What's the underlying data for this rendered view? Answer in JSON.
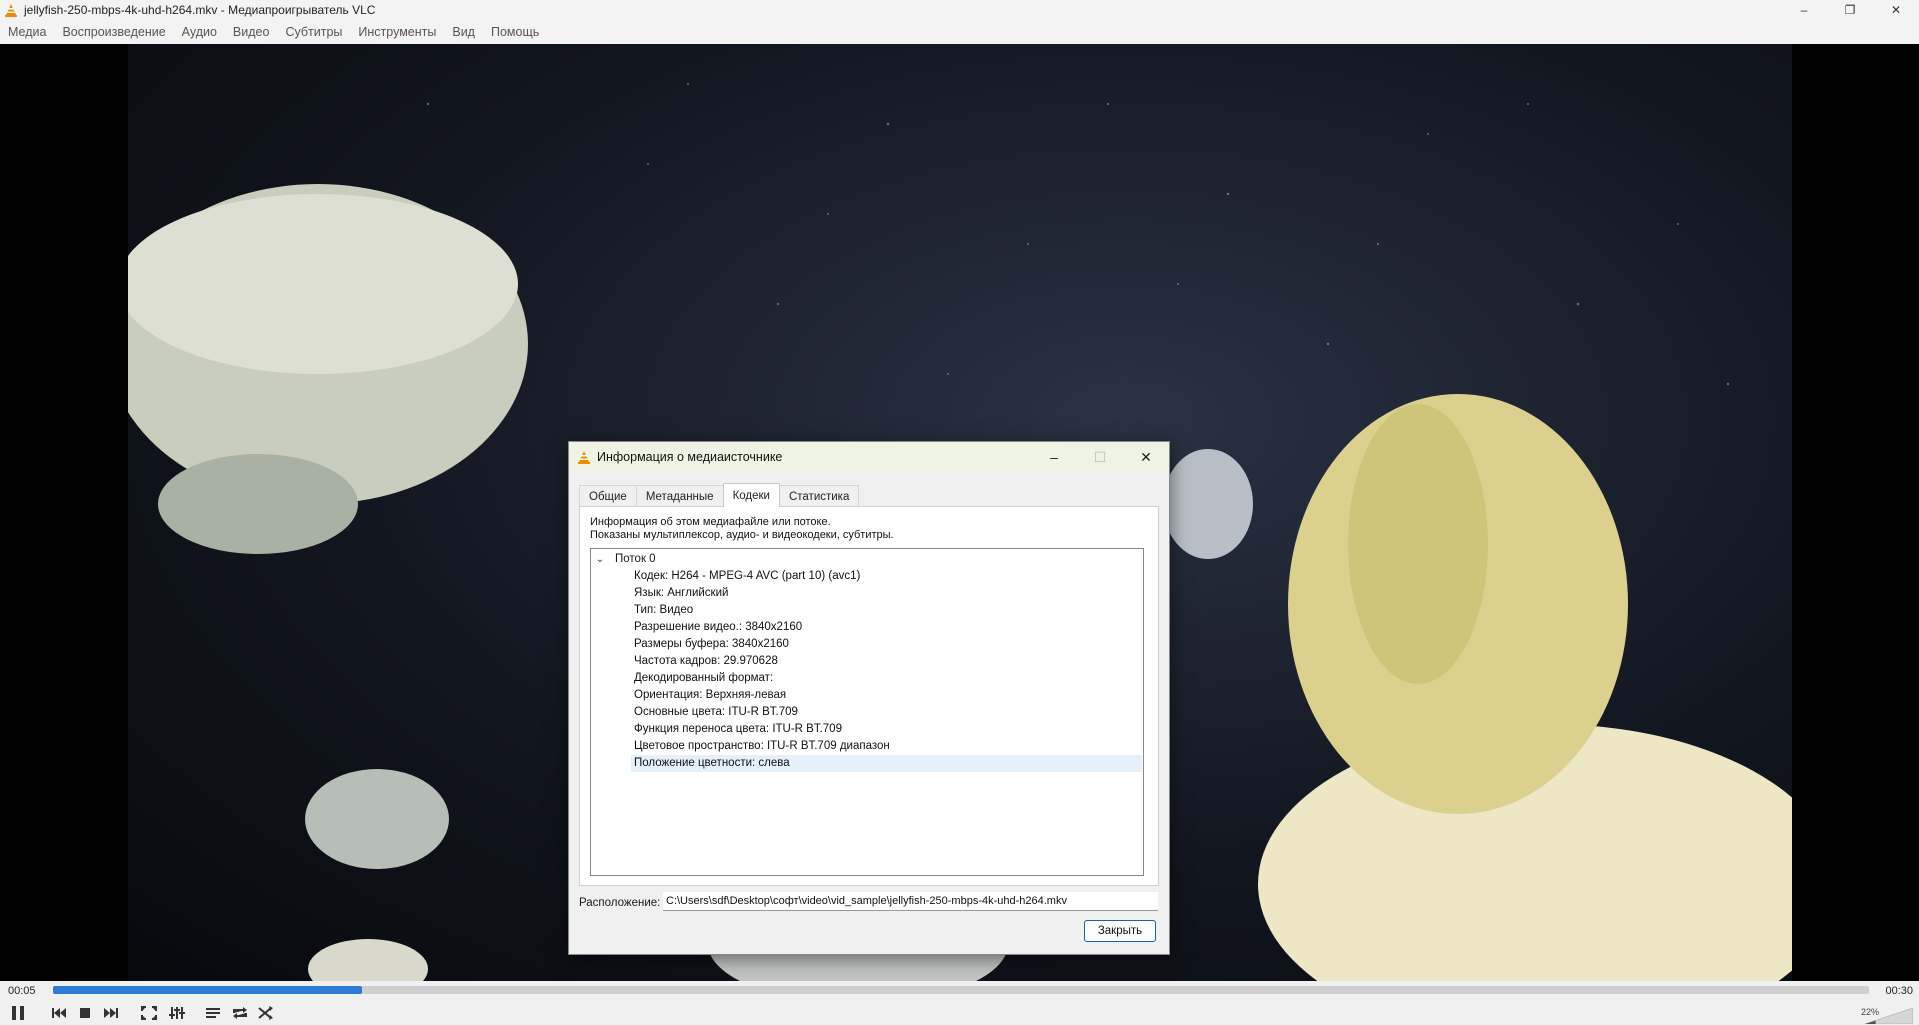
{
  "window": {
    "title": "jellyfish-250-mbps-4k-uhd-h264.mkv - Медиапроигрыватель VLC",
    "controls": [
      "–",
      "❐",
      "✕"
    ]
  },
  "menu": [
    "Медиа",
    "Воспроизведение",
    "Аудио",
    "Видео",
    "Субтитры",
    "Инструменты",
    "Вид",
    "Помощь"
  ],
  "dialog": {
    "title": "Информация о медиаисточнике",
    "tabs": [
      {
        "label": "Общие",
        "active": false
      },
      {
        "label": "Метаданные",
        "active": false
      },
      {
        "label": "Кодеки",
        "active": true
      },
      {
        "label": "Статистика",
        "active": false
      }
    ],
    "description_line1": "Информация об этом медиафайле или потоке.",
    "description_line2": "Показаны мультиплексор, аудио- и видеокодеки, субтитры.",
    "stream": {
      "label": "Поток 0",
      "items": [
        "Кодек: H264 - MPEG-4 AVC (part 10) (avc1)",
        "Язык: Английский",
        "Тип: Видео",
        "Разрешение видео.: 3840x2160",
        "Размеры буфера: 3840x2160",
        "Частота кадров: 29.970628",
        "Декодированный формат:",
        "Ориентация: Верхняя-левая",
        "Основные цвета: ITU-R BT.709",
        "Функция переноса цвета: ITU-R BT.709",
        "Цветовое пространство: ITU-R BT.709 диапазон",
        "Положение цветности: слева"
      ],
      "selected_index": 11
    },
    "location_label": "Расположение:",
    "location_value": "C:\\Users\\sdf\\Desktop\\софт\\video\\vid_sample\\jellyfish-250-mbps-4k-uhd-h264.mkv",
    "close_label": "Закрыть"
  },
  "player": {
    "time_elapsed": "00:05",
    "time_total": "00:30",
    "progress_fraction": 0.17,
    "volume": "22%"
  },
  "colors": {
    "accent": "#2d7bd4",
    "dialog_title_bg": "#eef3e3",
    "selection": "#e5f0fb"
  }
}
